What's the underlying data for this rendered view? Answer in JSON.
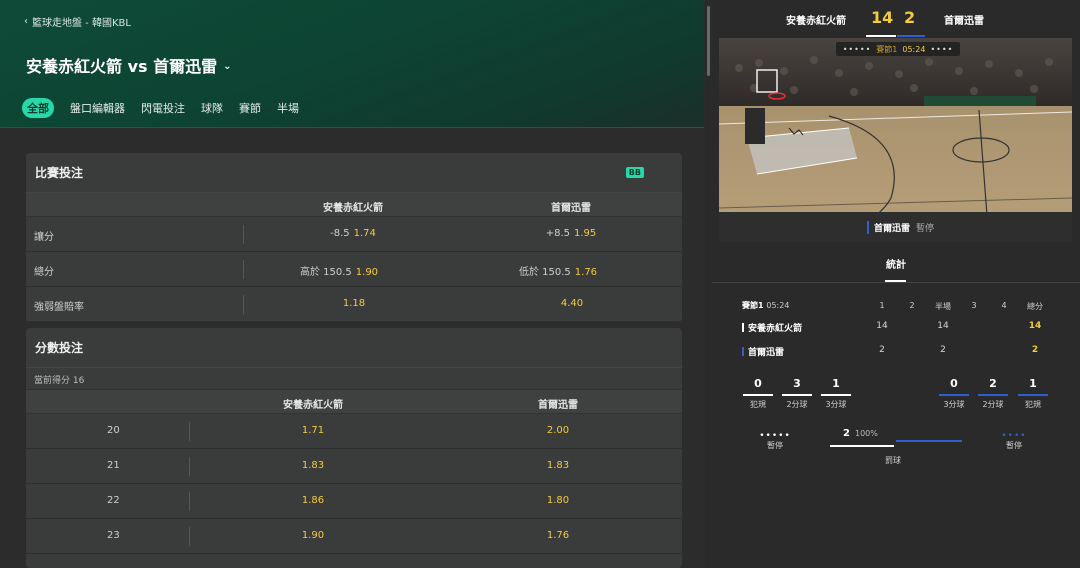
{
  "breadcrumb": "籃球走地盤 - 韓國KBL",
  "match_title": "安養赤紅火箭 vs 首爾迅雷",
  "tabs": [
    "全部",
    "盤口編輯器",
    "閃電投注",
    "球隊",
    "賽節",
    "半場"
  ],
  "match_panel": {
    "title": "比賽投注",
    "badge": "BB",
    "home": "安養赤紅火箭",
    "away": "首爾迅雷",
    "rows": [
      {
        "label": "讓分",
        "home_hd": "-8.5",
        "home_odd": "1.74",
        "away_hd": "+8.5",
        "away_odd": "1.95"
      },
      {
        "label": "總分",
        "home_hd": "高於 150.5",
        "home_odd": "1.90",
        "away_hd": "低於 150.5",
        "away_odd": "1.76"
      },
      {
        "label": "強弱盤賠率",
        "home_hd": "",
        "home_odd": "1.18",
        "away_hd": "",
        "away_odd": "4.40"
      }
    ]
  },
  "score_panel": {
    "title": "分數投注",
    "current": "當前得分 16",
    "home": "安養赤紅火箭",
    "away": "首爾迅雷",
    "rows": [
      {
        "n": "20",
        "h": "1.71",
        "a": "2.00"
      },
      {
        "n": "21",
        "h": "1.83",
        "a": "1.83"
      },
      {
        "n": "22",
        "h": "1.86",
        "a": "1.80"
      },
      {
        "n": "23",
        "h": "1.90",
        "a": "1.76"
      }
    ]
  },
  "scoreboard": {
    "home": "安養赤紅火箭",
    "away": "首爾迅雷",
    "home_score": "14",
    "away_score": "2",
    "quarter": "賽節1",
    "clock": "05:24",
    "dots": "•••••",
    "dots_right": "••••"
  },
  "court_footer": {
    "team": "首爾迅雷",
    "status": "暫停"
  },
  "stats": {
    "tab": "統計",
    "period": "賽節1",
    "clock": "05:24",
    "cols": [
      "1",
      "2",
      "半場",
      "3",
      "4",
      "總分"
    ],
    "home": {
      "name": "安養赤紅火箭",
      "vals": [
        "14",
        "",
        "14",
        "",
        "",
        "14"
      ]
    },
    "away": {
      "name": "首爾迅雷",
      "vals": [
        "2",
        "",
        "2",
        "",
        "",
        "2"
      ]
    },
    "home_mini": [
      {
        "v": "0",
        "l": "犯規"
      },
      {
        "v": "3",
        "l": "2分球"
      },
      {
        "v": "1",
        "l": "3分球"
      }
    ],
    "away_mini": [
      {
        "v": "0",
        "l": "3分球"
      },
      {
        "v": "2",
        "l": "2分球"
      },
      {
        "v": "1",
        "l": "犯規"
      }
    ],
    "timeout_label": "暫停",
    "home_timeouts": "•••••",
    "away_timeouts": "••••",
    "possession_value": "2",
    "possession_pct": "100%",
    "possession_label": "罰球"
  },
  "colors": {
    "accent": "#26d9a8",
    "odds": "#f5cb3c",
    "away": "#2f5fcf",
    "home": "#ffffff"
  }
}
